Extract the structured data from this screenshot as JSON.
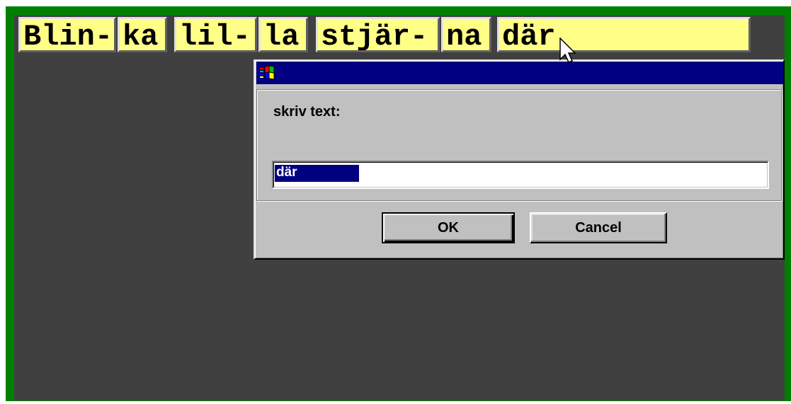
{
  "syllables": [
    "Blin-",
    "ka",
    "lil-",
    "la",
    "stjär-",
    "na",
    "där"
  ],
  "dialog": {
    "title_icon": "windows-flag-icon",
    "prompt_label": "skriv text:",
    "input_value": "där",
    "input_selected": true,
    "ok_label": "OK",
    "cancel_label": "Cancel"
  },
  "cursor_icon": "arrow-cursor-icon",
  "colors": {
    "frame": "#008000",
    "workspace": "#404040",
    "syllable_box": "#ffff88",
    "dialog_face": "#c0c0c0",
    "title_bar": "#000080",
    "selection": "#000080"
  }
}
